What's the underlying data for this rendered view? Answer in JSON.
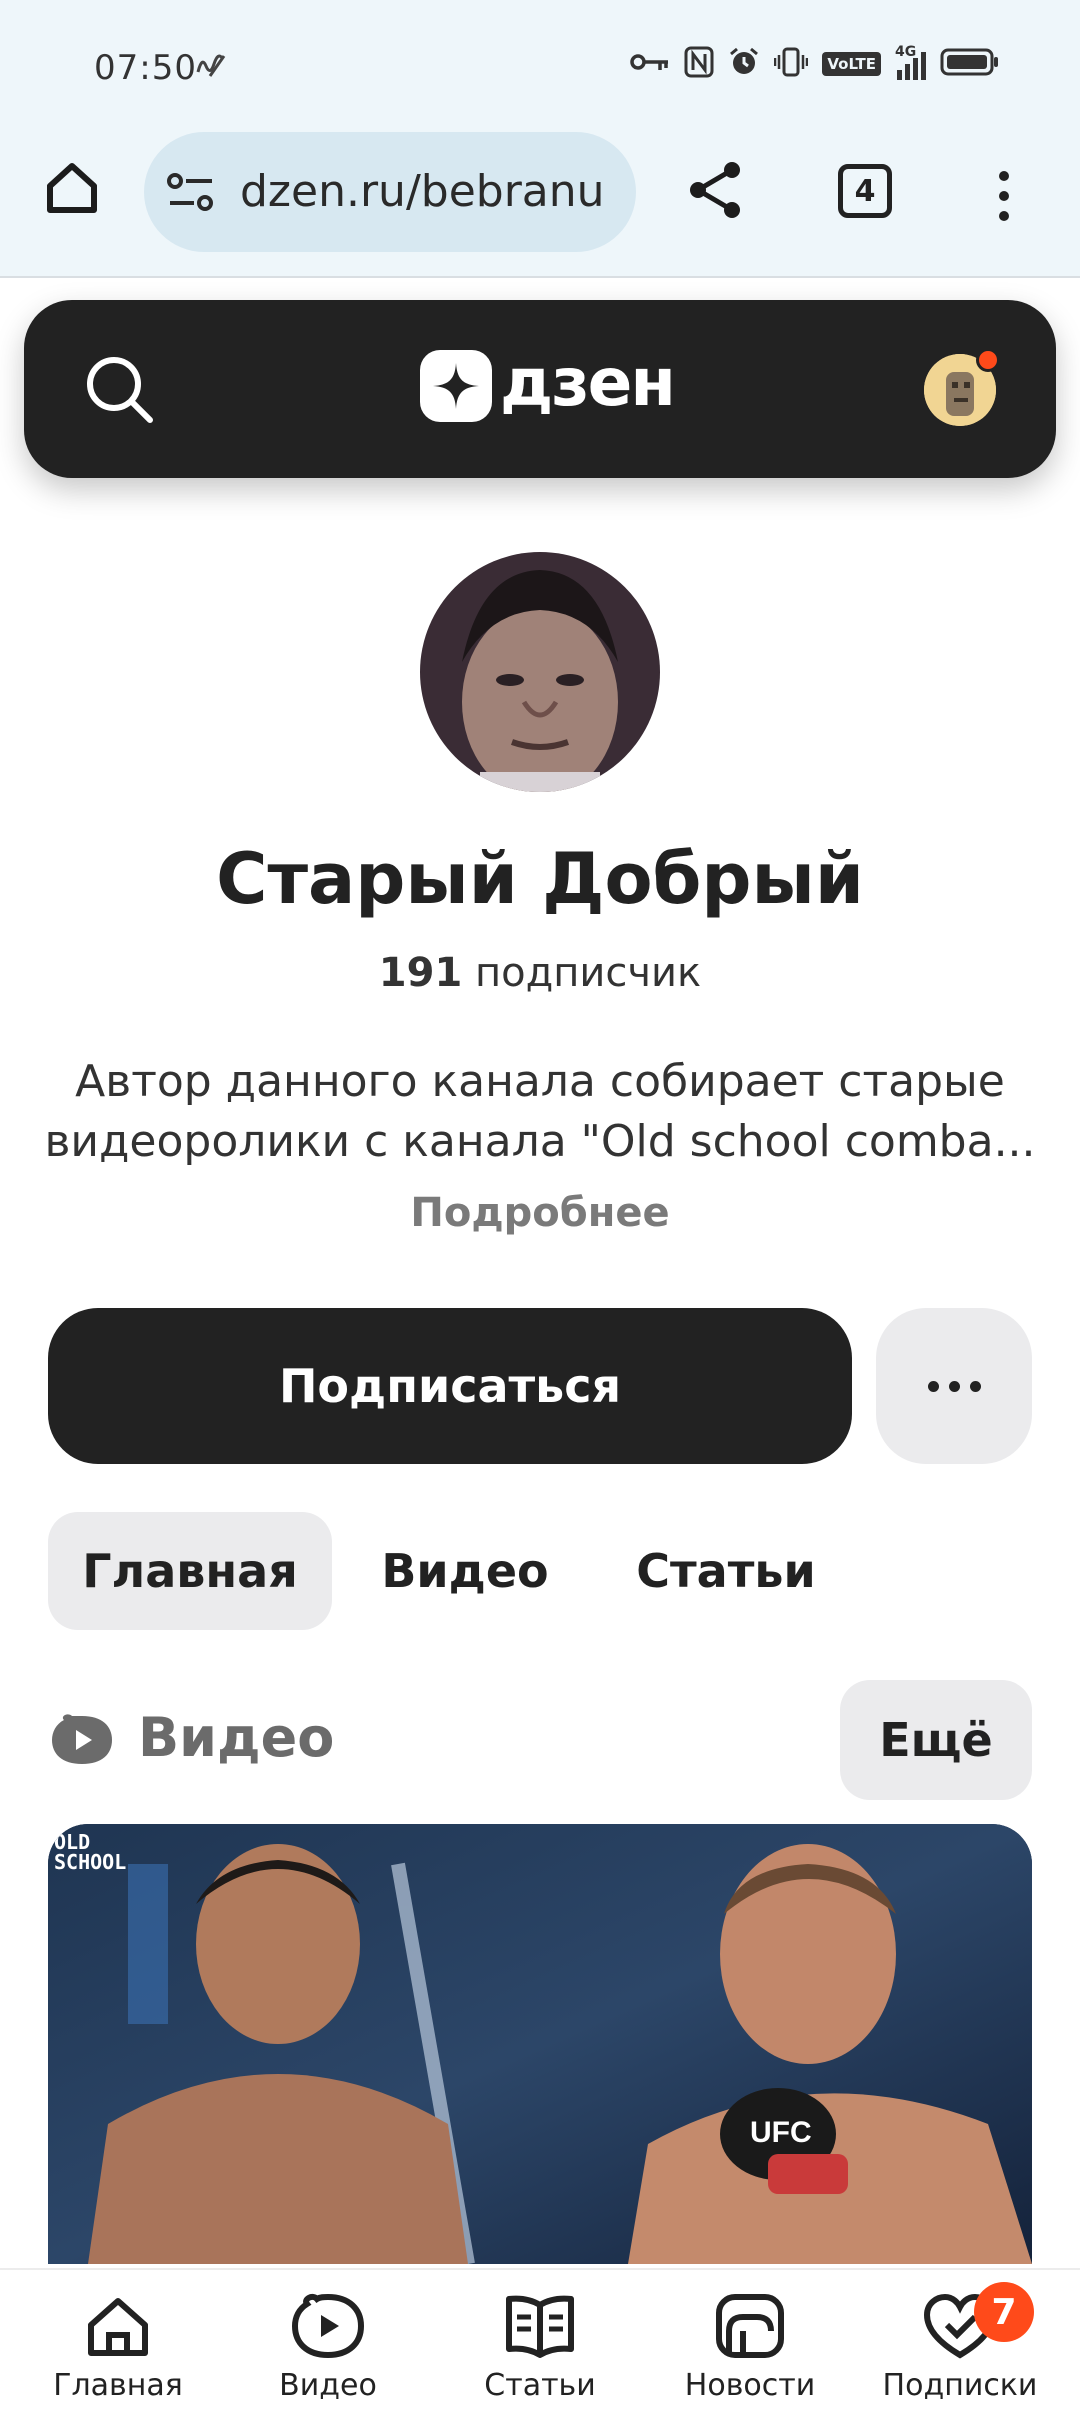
{
  "status_bar": {
    "time": "07:50",
    "icons": [
      "wave-icon",
      "key-icon",
      "nfc-icon",
      "alarm-icon",
      "vibrate-icon",
      "volte-icon",
      "signal-icon",
      "battery-icon"
    ],
    "volte": "VoLTE",
    "network": "4G"
  },
  "browser": {
    "url": "dzen.ru/bebranu",
    "tab_count": "4"
  },
  "dzen": {
    "logo_text": "дзен",
    "accent": "#ff4a1a"
  },
  "channel": {
    "name": "Старый Добрый",
    "subscriber_count": "191",
    "subscriber_label": "подписчик",
    "description_line1": "Автор данного канала собирает старые",
    "description_line2": "видеоролики с канала \"Old school comba...",
    "more_link": "Подробнее",
    "subscribe_label": "Подписаться"
  },
  "tabs": [
    {
      "label": "Главная",
      "active": true
    },
    {
      "label": "Видео",
      "active": false
    },
    {
      "label": "Статьи",
      "active": false
    }
  ],
  "section": {
    "title": "Видео",
    "more_label": "Ещё"
  },
  "video": {
    "watermark_line1": "OLD",
    "watermark_line2": "SCHOOL",
    "glove_text": "UFC"
  },
  "bottom_nav": {
    "items": [
      {
        "label": "Главная",
        "icon": "home-icon"
      },
      {
        "label": "Видео",
        "icon": "play-icon"
      },
      {
        "label": "Статьи",
        "icon": "book-icon"
      },
      {
        "label": "Новости",
        "icon": "news-icon"
      },
      {
        "label": "Подписки",
        "icon": "subscriptions-icon"
      }
    ],
    "badge": "7"
  }
}
